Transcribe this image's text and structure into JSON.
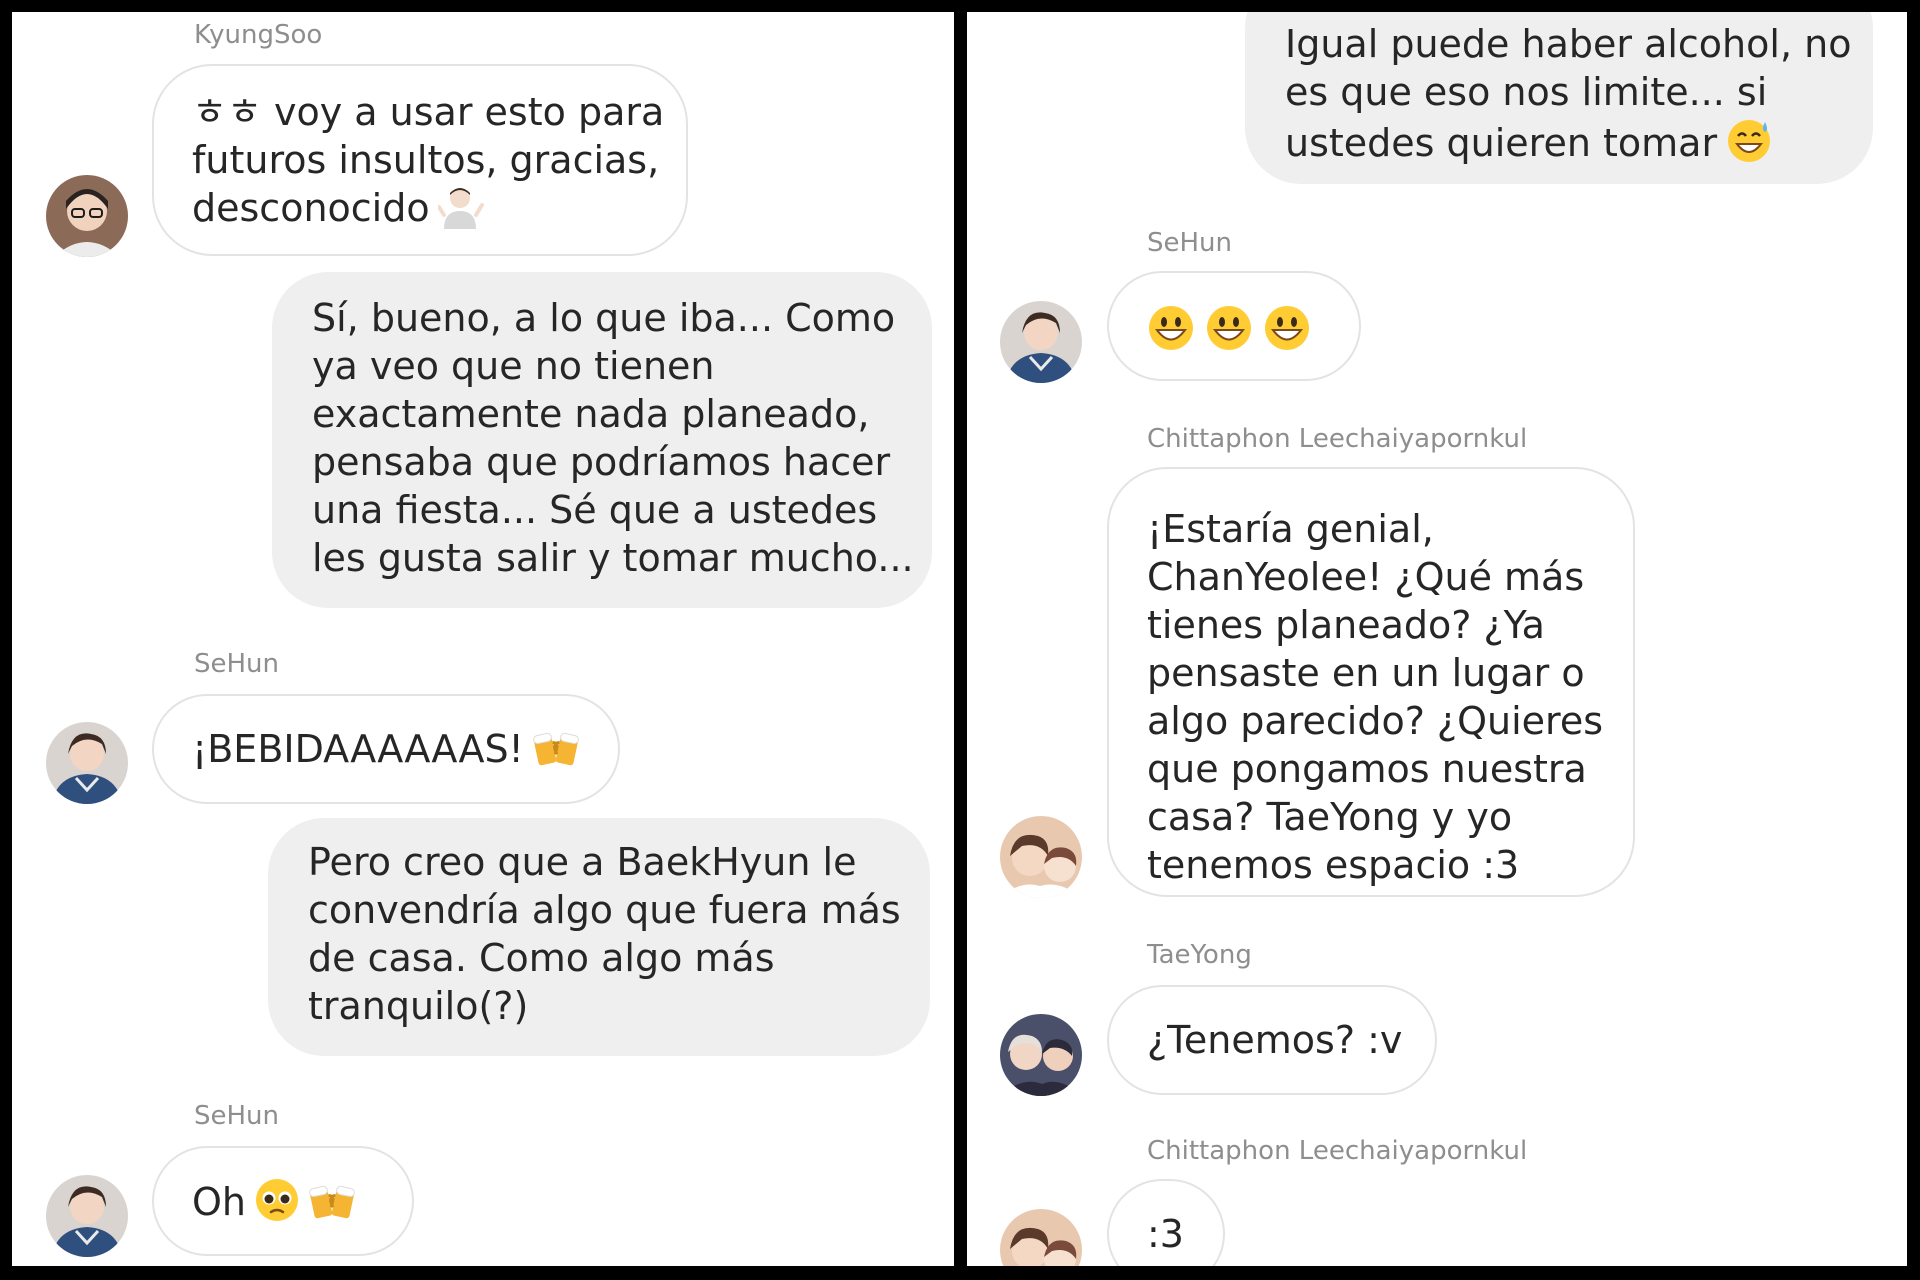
{
  "left_panel": {
    "messages": [
      {
        "id": "m1",
        "sender": "KyungSoo",
        "direction": "incoming",
        "lines": [
          "ㅎㅎ voy a usar esto para",
          "futuros insultos, gracias,",
          "desconocido"
        ],
        "emoji": "person-shrugging-emoji"
      },
      {
        "id": "m2",
        "direction": "outgoing",
        "lines": [
          "Sí, bueno, a lo que iba... Como",
          "ya veo que no tienen",
          "exactamente nada planeado,",
          "pensaba que podríamos hacer",
          "una fiesta... Sé que a ustedes",
          "les gusta salir y tomar mucho..."
        ]
      },
      {
        "id": "m3",
        "sender": "SeHun",
        "direction": "incoming",
        "lines": [
          "¡BEBIDAAAAAAS!"
        ],
        "emoji": "clinking-beer-mugs-emoji"
      },
      {
        "id": "m4",
        "direction": "outgoing",
        "lines": [
          "Pero creo que a BaekHyun le",
          "convendría algo que fuera más",
          "de casa. Como algo más",
          "tranquilo(?)"
        ]
      },
      {
        "id": "m5",
        "sender": "SeHun",
        "direction": "incoming",
        "lines": [
          "Oh"
        ],
        "emoji": "pleading-face-and-beer-mugs-emoji"
      }
    ]
  },
  "right_panel": {
    "messages": [
      {
        "id": "r1",
        "direction": "outgoing",
        "lines": [
          "Igual puede haber alcohol, no",
          "es que eso nos limite... si",
          "ustedes quieren tomar"
        ],
        "emoji": "grinning-sweat-emoji"
      },
      {
        "id": "r2",
        "sender": "SeHun",
        "direction": "incoming",
        "lines": [
          ""
        ],
        "emoji": "three-smiley-faces-emoji"
      },
      {
        "id": "r3",
        "sender": "Chittaphon Leechaiyapornkul",
        "direction": "incoming",
        "lines": [
          "¡Estaría genial,",
          "ChanYeolee! ¿Qué más",
          "tienes planeado? ¿Ya",
          "pensaste en un lugar o",
          "algo parecido? ¿Quieres",
          "que pongamos nuestra",
          "casa? TaeYong y yo",
          "tenemos espacio :3"
        ]
      },
      {
        "id": "r4",
        "sender": "TaeYong",
        "direction": "incoming",
        "lines": [
          "¿Tenemos? :v"
        ]
      },
      {
        "id": "r5",
        "sender": "Chittaphon Leechaiyapornkul",
        "direction": "incoming",
        "lines": [
          ":3"
        ]
      }
    ]
  },
  "colors": {
    "page_border": "#000000",
    "panel_background": "#ffffff",
    "outgoing_bubble": "#efefef",
    "incoming_border": "#e3e3e3",
    "message_text": "#262626",
    "sender_name": "#8e8e8e"
  }
}
